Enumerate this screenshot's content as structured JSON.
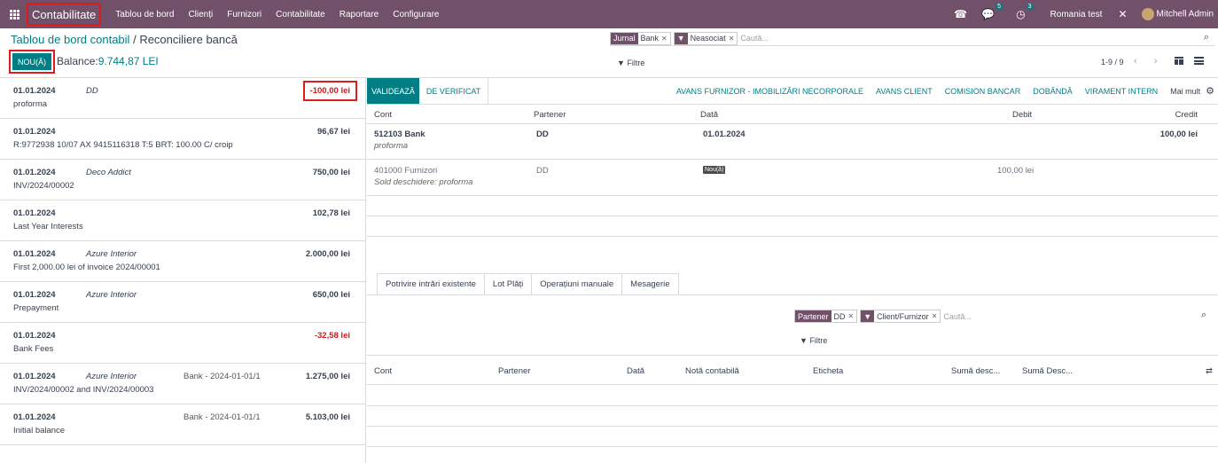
{
  "navbar": {
    "brand": "Contabilitate",
    "menu": [
      "Tablou de bord",
      "Clienți",
      "Furnizori",
      "Contabilitate",
      "Raportare",
      "Configurare"
    ],
    "messages_count": "5",
    "activities_count": "3",
    "company": "Romania test",
    "user": "Mitchell Admin"
  },
  "control": {
    "breadcrumb_parent": "Tablou de bord contabil",
    "breadcrumb_sep": "/",
    "breadcrumb_current": "Reconciliere bancă",
    "new_label": "NOU(Ă)",
    "balance_label": "Balance:",
    "balance_value": "9.744,87 LEI",
    "filters_label": "Filtre",
    "pager": "1-9 / 9",
    "pager_arrows": "‹ ›"
  },
  "search": {
    "facets": [
      {
        "tag": "Jurnal",
        "value": "Bank"
      },
      {
        "tag": "▼",
        "value": "Neasociat"
      }
    ],
    "placeholder": "Caută..."
  },
  "lines": [
    {
      "date": "01.01.2024",
      "partner": "DD",
      "ref": "",
      "amount": "-100,00 lei",
      "label": "proforma",
      "negative": true
    },
    {
      "date": "01.01.2024",
      "partner": "",
      "ref": "",
      "amount": "96,67 lei",
      "label": "R:9772938 10/07 AX 9415116318 T:5 BRT: 100.00 C/ croip",
      "negative": false
    },
    {
      "date": "01.01.2024",
      "partner": "Deco Addict",
      "ref": "",
      "amount": "750,00 lei",
      "label": "INV/2024/00002",
      "negative": false
    },
    {
      "date": "01.01.2024",
      "partner": "",
      "ref": "",
      "amount": "102,78 lei",
      "label": "Last Year Interests",
      "negative": false
    },
    {
      "date": "01.01.2024",
      "partner": "Azure Interior",
      "ref": "",
      "amount": "2.000,00 lei",
      "label": "First 2,000.00 lei of invoice 2024/00001",
      "negative": false
    },
    {
      "date": "01.01.2024",
      "partner": "Azure Interior",
      "ref": "",
      "amount": "650,00 lei",
      "label": "Prepayment",
      "negative": false
    },
    {
      "date": "01.01.2024",
      "partner": "",
      "ref": "",
      "amount": "-32,58 lei",
      "label": "Bank Fees",
      "negative": true
    },
    {
      "date": "01.01.2024",
      "partner": "Azure Interior",
      "ref": "Bank - 2024-01-01/1",
      "amount": "1.275,00 lei",
      "label": "INV/2024/00002 and INV/2024/00003",
      "negative": false
    },
    {
      "date": "01.01.2024",
      "partner": "",
      "ref": "Bank - 2024-01-01/1",
      "amount": "5.103,00 lei",
      "label": "Initial balance",
      "negative": false
    }
  ],
  "actions": {
    "validate": "VALIDEAZĂ",
    "to_check": "DE VERIFICAT",
    "models": [
      "AVANS FURNIZOR - IMOBILIZĂRI NECORPORALE",
      "AVANS CLIENT",
      "COMISION BANCAR",
      "DOBÂNDĂ",
      "VIRAMENT INTERN"
    ],
    "more": "Mai mult"
  },
  "grid": {
    "headers": {
      "account": "Cont",
      "partner": "Partener",
      "date": "Dată",
      "debit": "Debit",
      "credit": "Credit"
    },
    "rows": [
      {
        "account": "512103 Bank",
        "account_sub": "proforma",
        "partner": "DD",
        "date": "01.01.2024",
        "debit": "",
        "credit": "100,00 lei"
      },
      {
        "account": "401000 Furnizori",
        "account_sub": "Sold deschidere: proforma",
        "partner": "DD",
        "status": "Nou(ă)",
        "debit": "100,00 lei",
        "credit": ""
      }
    ]
  },
  "tabs": [
    "Potrivire intrări existente",
    "Lot Plăți",
    "Operațiuni manuale",
    "Mesagerie"
  ],
  "search2": {
    "facets": [
      {
        "tag": "Partener",
        "value": "DD"
      },
      {
        "tag": "▼",
        "value": "Client/Furnizor"
      }
    ],
    "placeholder": "Caută...",
    "filters_label": "Filtre"
  },
  "amls": {
    "headers": [
      "Cont",
      "Partener",
      "Dată",
      "Notă contabilă",
      "Eticheta",
      "Sumă desc...",
      "Sumă Desc..."
    ]
  }
}
